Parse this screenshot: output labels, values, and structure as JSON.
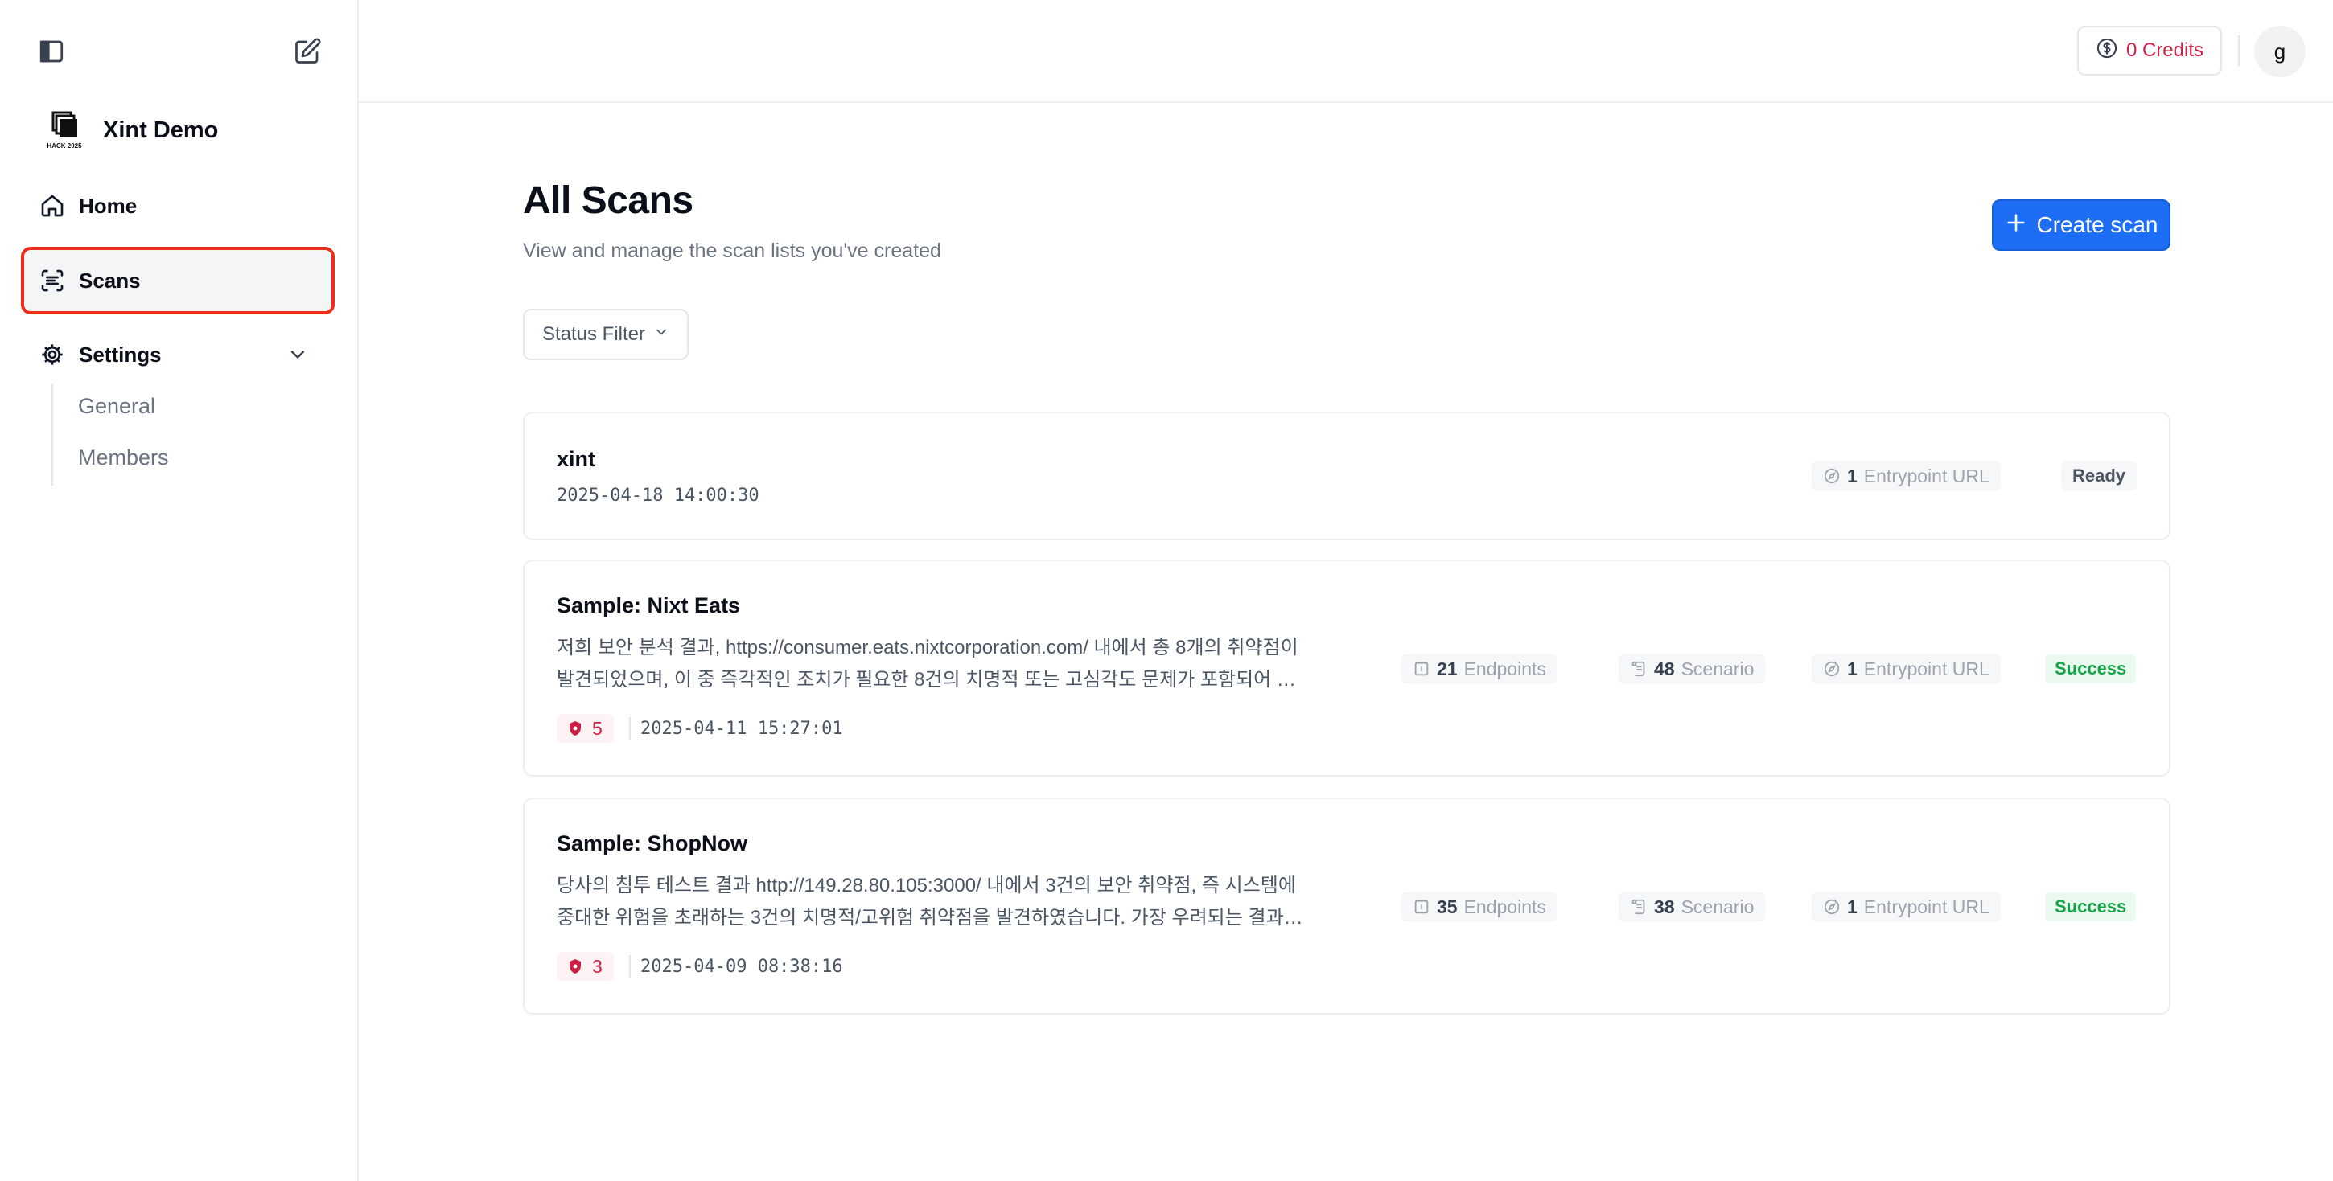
{
  "sidebar": {
    "brand_name": "Xint Demo",
    "brand_logo_text": "HACK 2025",
    "nav": [
      {
        "label": "Home",
        "icon": "home-icon"
      },
      {
        "label": "Scans",
        "icon": "scan-list-icon",
        "active": true
      },
      {
        "label": "Settings",
        "icon": "gear-icon"
      }
    ],
    "settings_sub": [
      "General",
      "Members"
    ]
  },
  "header": {
    "credits_label": "0 Credits",
    "avatar_initial": "g"
  },
  "main": {
    "title": "All Scans",
    "subtitle": "View and manage the scan lists you've created",
    "create_button": "Create scan",
    "status_filter": "Status Filter"
  },
  "scans": [
    {
      "name": "xint",
      "date": "2025-04-18 14:00:30",
      "entrypoint_count": "1",
      "entrypoint_label": "Entrypoint URL",
      "status": "Ready"
    },
    {
      "name": "Sample: Nixt Eats",
      "desc_line1": "저희 보안 분석 결과, https://consumer.eats.nixtcorporation.com/ 내에서 총 8개의 취약점이",
      "desc_line2": "발견되었으며, 이 중 즉각적인 조치가 필요한 8건의 치명적 또는 고심각도 문제가 포함되어 있습니다. 가장 우려되는",
      "vuln_count": "5",
      "date": "2025-04-11 15:27:01",
      "endpoints_count": "21",
      "endpoints_label": "Endpoints",
      "scenario_count": "48",
      "scenario_label": "Scenario",
      "entrypoint_count": "1",
      "entrypoint_label": "Entrypoint URL",
      "status": "Success"
    },
    {
      "name": "Sample: ShopNow",
      "desc_line1": "당사의 침투 테스트 결과 http://149.28.80.105:3000/ 내에서 3건의 보안 취약점, 즉 시스템에",
      "desc_line2": "중대한 위험을 초래하는 3건의 치명적/고위험 취약점을 발견하였습니다. 가장 우려되는 결과로는 인증 우회",
      "vuln_count": "3",
      "date": "2025-04-09 08:38:16",
      "endpoints_count": "35",
      "endpoints_label": "Endpoints",
      "scenario_count": "38",
      "scenario_label": "Scenario",
      "entrypoint_count": "1",
      "entrypoint_label": "Entrypoint URL",
      "status": "Success"
    }
  ],
  "colors": {
    "accent": "#1d6ef5",
    "credits": "#d01f45",
    "success": "#16a34a",
    "highlight_box": "#ee2e1b"
  }
}
